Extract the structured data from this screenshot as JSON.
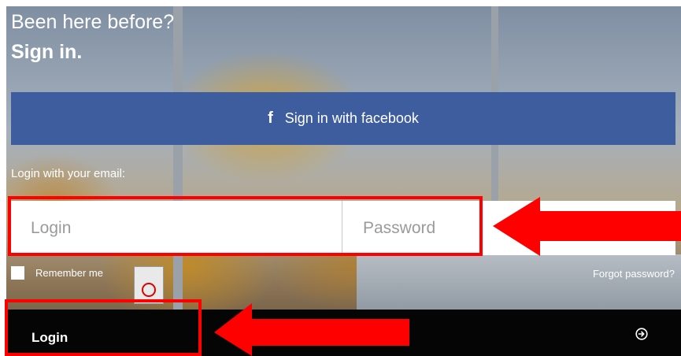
{
  "heading": {
    "line1": "Been here before?",
    "line2": "Sign in."
  },
  "facebook": {
    "icon": "facebook-f-icon",
    "label": "Sign in with facebook",
    "color": "#3e5d9e"
  },
  "email_section": {
    "label": "Login with your email:"
  },
  "form": {
    "login_placeholder": "Login",
    "password_placeholder": "Password",
    "login_value": "",
    "password_value": "",
    "remember_label": "Remember me",
    "remember_checked": false,
    "forgot_label": "Forgot password?"
  },
  "login_bar": {
    "label": "Login",
    "icon": "arrow-circle-right-icon"
  },
  "annotations": {
    "highlight_color": "#ff0000"
  }
}
